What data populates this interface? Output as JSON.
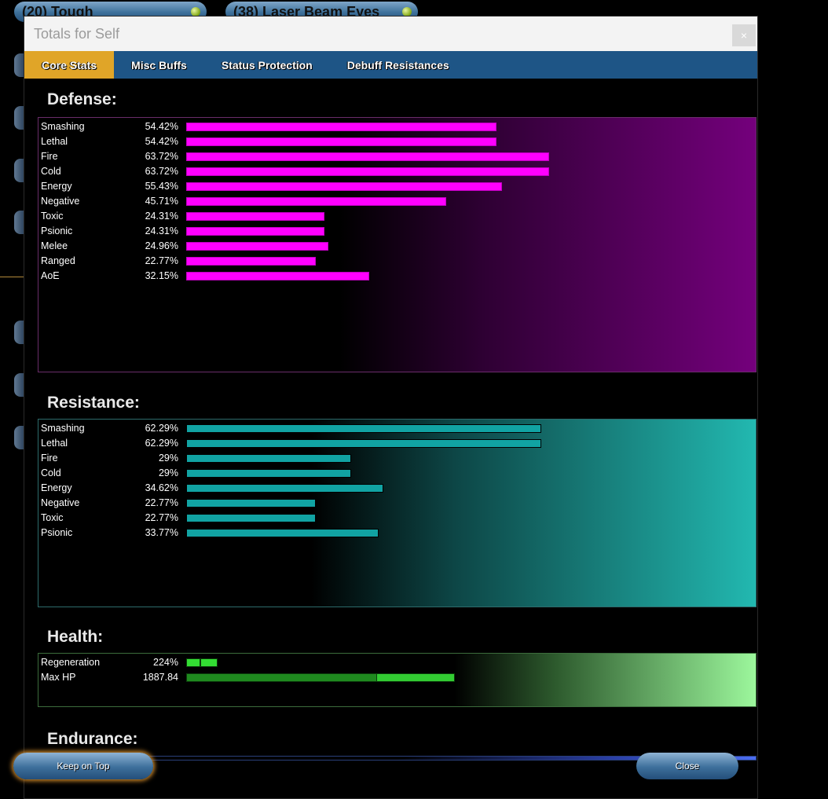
{
  "background": {
    "powers": [
      {
        "label": "(20) Tough"
      },
      {
        "label": "(38) Laser Beam Eyes"
      }
    ]
  },
  "dialog": {
    "title": "Totals for Self",
    "close_glyph": "×",
    "tabs": [
      {
        "label": "Core Stats",
        "active": true
      },
      {
        "label": "Misc Buffs",
        "active": false
      },
      {
        "label": "Status Protection",
        "active": false
      },
      {
        "label": "Debuff Resistances",
        "active": false
      }
    ],
    "defense": {
      "title": "Defense:",
      "rows": [
        {
          "label": "Smashing",
          "value": "54.42%",
          "fraction": 0.5442
        },
        {
          "label": "Lethal",
          "value": "54.42%",
          "fraction": 0.5442
        },
        {
          "label": "Fire",
          "value": "63.72%",
          "fraction": 0.6372
        },
        {
          "label": "Cold",
          "value": "63.72%",
          "fraction": 0.6372
        },
        {
          "label": "Energy",
          "value": "55.43%",
          "fraction": 0.5543
        },
        {
          "label": "Negative",
          "value": "45.71%",
          "fraction": 0.4571
        },
        {
          "label": "Toxic",
          "value": "24.31%",
          "fraction": 0.2431
        },
        {
          "label": "Psionic",
          "value": "24.31%",
          "fraction": 0.2431
        },
        {
          "label": "Melee",
          "value": "24.96%",
          "fraction": 0.2496
        },
        {
          "label": "Ranged",
          "value": "22.77%",
          "fraction": 0.2277
        },
        {
          "label": "AoE",
          "value": "32.15%",
          "fraction": 0.3215
        }
      ]
    },
    "resistance": {
      "title": "Resistance:",
      "rows": [
        {
          "label": "Smashing",
          "value": "62.29%",
          "fraction": 0.6229
        },
        {
          "label": "Lethal",
          "value": "62.29%",
          "fraction": 0.6229
        },
        {
          "label": "Fire",
          "value": "29%",
          "fraction": 0.29
        },
        {
          "label": "Cold",
          "value": "29%",
          "fraction": 0.29
        },
        {
          "label": "Energy",
          "value": "34.62%",
          "fraction": 0.3462
        },
        {
          "label": "Negative",
          "value": "22.77%",
          "fraction": 0.2277
        },
        {
          "label": "Toxic",
          "value": "22.77%",
          "fraction": 0.2277
        },
        {
          "label": "Psionic",
          "value": "33.77%",
          "fraction": 0.3377
        }
      ]
    },
    "health": {
      "title": "Health:",
      "regeneration": {
        "label": "Regeneration",
        "value": "224%"
      },
      "max_hp": {
        "label": "Max HP",
        "value": "1887.84"
      }
    },
    "endurance": {
      "title": "Endurance:"
    },
    "buttons": {
      "keep_on_top": "Keep on Top",
      "close": "Close"
    }
  }
}
